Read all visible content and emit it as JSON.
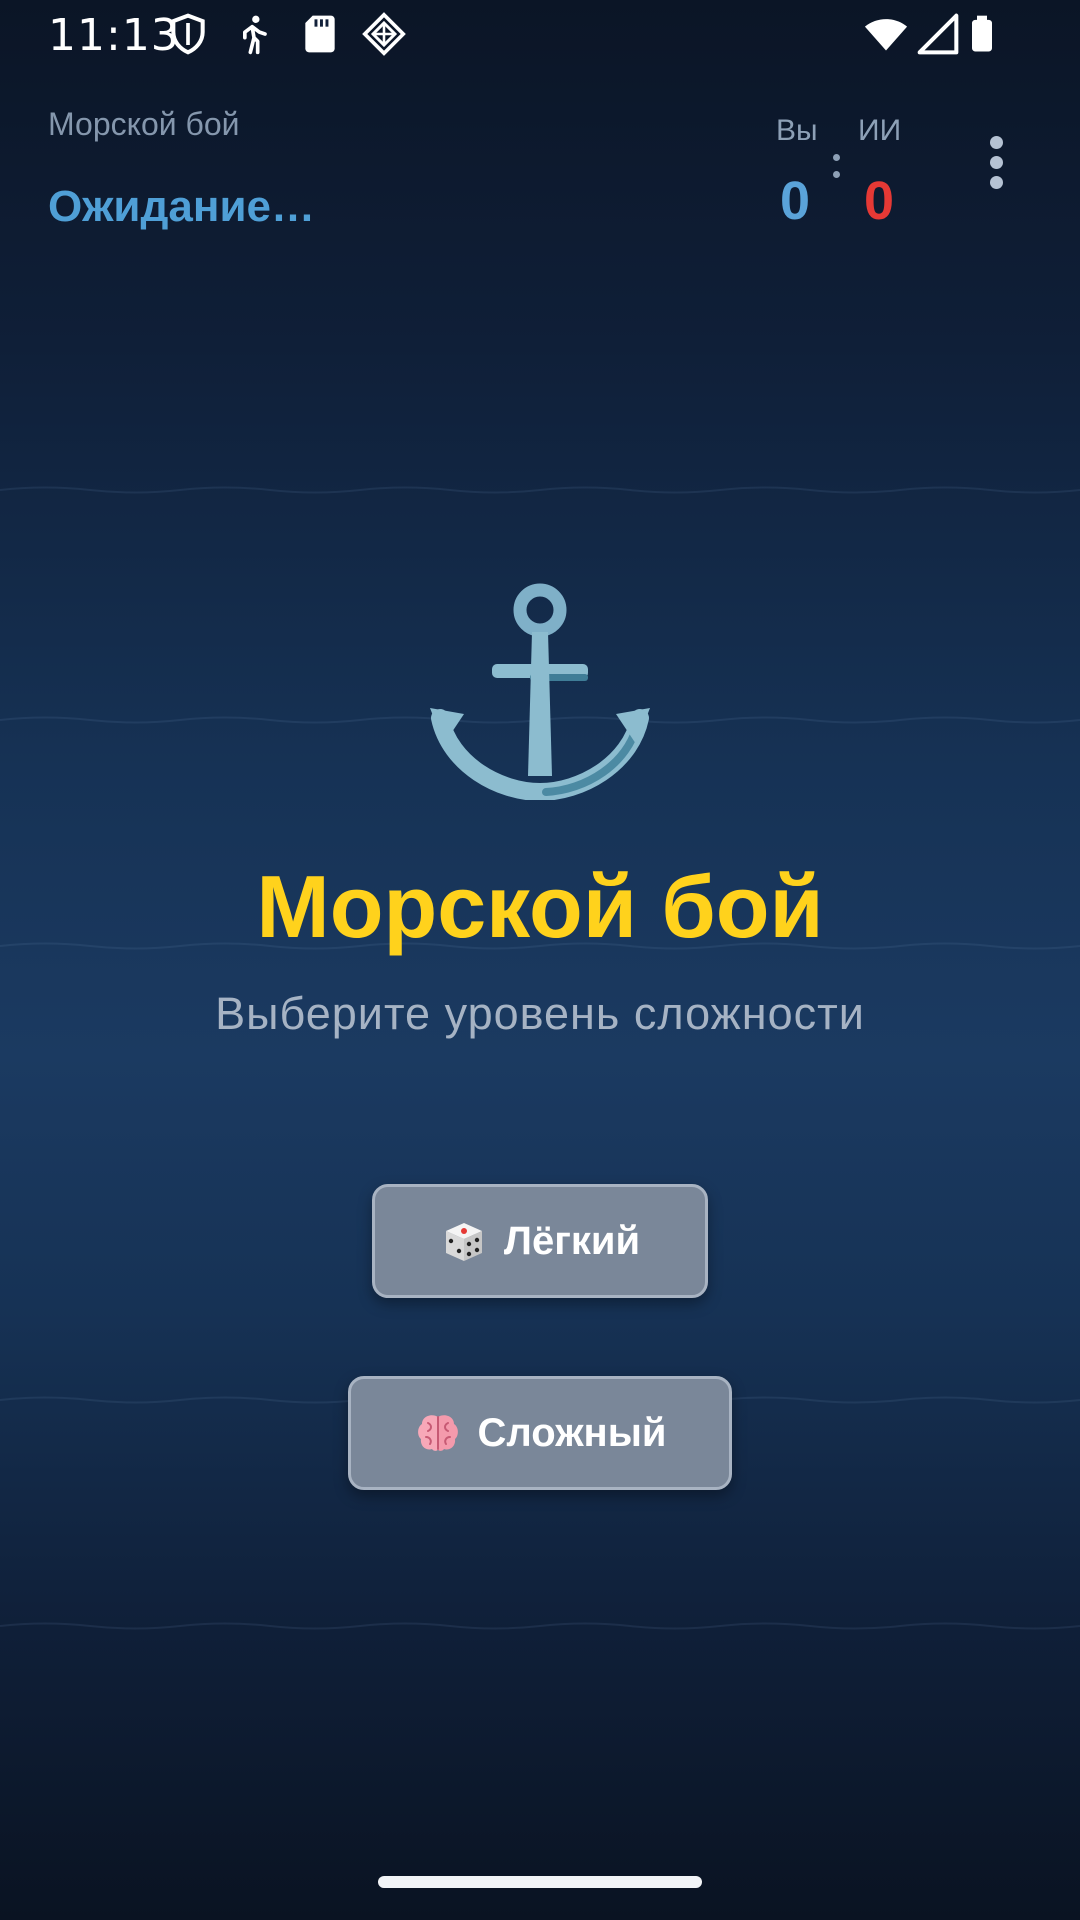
{
  "status_bar": {
    "time": "11:13",
    "icons": [
      "shield-icon",
      "walking-icon",
      "sd-card-icon",
      "app-diamond-icon",
      "wifi-icon",
      "signal-icon",
      "battery-icon"
    ]
  },
  "header": {
    "subtitle": "Морской бой",
    "status": "Ожидание…",
    "score": {
      "player_label": "Вы",
      "player_value": "0",
      "ai_label": "ИИ",
      "ai_value": "0"
    },
    "menu_icon": "more-vert-icon"
  },
  "hero": {
    "icon": "anchor-icon",
    "title": "Морской бой",
    "subtitle": "Выберите уровень сложности"
  },
  "buttons": {
    "easy": {
      "icon": "dice-icon",
      "label": "Лёгкий"
    },
    "hard": {
      "icon": "brain-icon",
      "label": "Сложный"
    }
  },
  "colors": {
    "title": "#ffd21c",
    "status": "#4f9fd6",
    "player_score": "#5aa3d9",
    "ai_score": "#e53935",
    "button_bg": "#7a8799"
  }
}
